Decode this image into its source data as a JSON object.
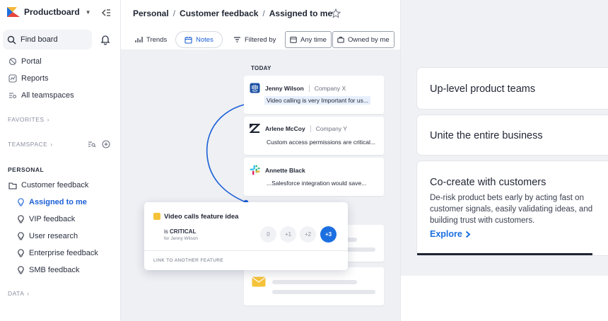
{
  "sidebar": {
    "brand": "Productboard",
    "find_board": "Find board",
    "top_items": [
      {
        "label": "Portal",
        "icon": "portal-icon"
      },
      {
        "label": "Reports",
        "icon": "reports-icon"
      },
      {
        "label": "All teamspaces",
        "icon": "teamspaces-icon"
      }
    ],
    "favorites_label": "FAVORITES",
    "teamspace_label": "TEAMSPACE",
    "personal_label": "PERSONAL",
    "folder": "Customer feedback",
    "boards": [
      {
        "label": "Assigned to me",
        "active": true
      },
      {
        "label": "VIP feedback",
        "active": false
      },
      {
        "label": "User research",
        "active": false
      },
      {
        "label": "Enterprise feedback",
        "active": false
      },
      {
        "label": "SMB feedback",
        "active": false
      }
    ],
    "data_label": "DATA"
  },
  "header": {
    "crumbs": [
      "Personal",
      "Customer feedback",
      "Assigned to me"
    ],
    "separator": "/"
  },
  "toolbar": {
    "trends": "Trends",
    "notes": "Notes",
    "filtered_by": "Filtered by",
    "any_time": "Any time",
    "owned_by": "Owned by me"
  },
  "feed": {
    "section": "TODAY",
    "notes": [
      {
        "name": "Jenny Wilson",
        "company": "Company X",
        "message": "Video calling is very Important for us...",
        "source": "intercom"
      },
      {
        "name": "Arlene McCoy",
        "company": "Company Y",
        "message": "Custom access permissions are critical...",
        "source": "zendesk"
      },
      {
        "name": "Annette Black",
        "company": "",
        "message": "...Salesforce integration would save...",
        "source": "slack"
      }
    ]
  },
  "popup": {
    "title": "Video calls feature idea",
    "is_prefix": "is",
    "importance": "CRITICAL",
    "for_who": "for Jenny Wilson",
    "scores": [
      "0",
      "+1",
      "+2",
      "+3"
    ],
    "selected_score": "+3",
    "link_label": "LINK TO ANOTHER FEATURE"
  },
  "panel": {
    "features": [
      {
        "title": "Up-level product teams"
      },
      {
        "title": "Unite the entire business"
      },
      {
        "title": "Co-create with customers",
        "description": "De-risk product bets early by acting fast on customer signals, easily validating ideas, and building trust with customers.",
        "cta": "Explore"
      }
    ]
  },
  "colors": {
    "accent": "#1b6fe0",
    "active_nav": "#1b5fd6",
    "highlight": "#e7effc",
    "note_square": "#f5c33a"
  }
}
